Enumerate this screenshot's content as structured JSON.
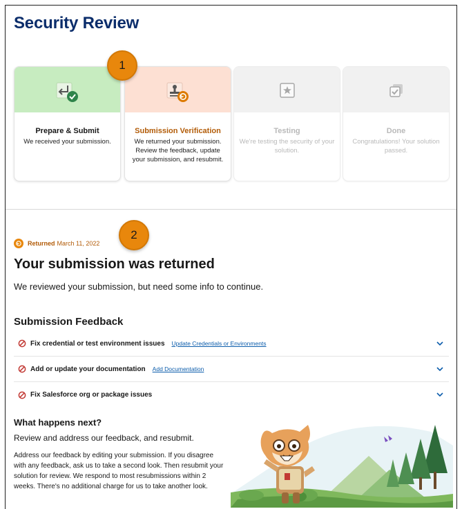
{
  "page": {
    "title": "Security Review"
  },
  "callouts": {
    "one": "1",
    "two": "2"
  },
  "stepper": {
    "steps": [
      {
        "title": "Prepare & Submit",
        "description": "We received your submission.",
        "state": "done",
        "icon": "enter-arrow-check-icon"
      },
      {
        "title": "Submission Verification",
        "description": "We returned your submission. Review the feedback, update your submission, and resubmit.",
        "state": "active",
        "icon": "stamp-returned-icon"
      },
      {
        "title": "Testing",
        "description": "We're testing the security of your solution.",
        "state": "pending",
        "icon": "star-square-icon"
      },
      {
        "title": "Done",
        "description": "Congratulations! Your solution passed.",
        "state": "pending",
        "icon": "stacked-check-icon"
      }
    ]
  },
  "status": {
    "label": "Returned",
    "date": "March 11, 2022"
  },
  "main": {
    "heading": "Your submission was returned",
    "subheading": "We reviewed your submission, but need some info to continue."
  },
  "feedback": {
    "heading": "Submission Feedback",
    "items": [
      {
        "title": "Fix credential or test environment issues",
        "link": "Update Credentials or Environments"
      },
      {
        "title": "Add or update your documentation",
        "link": "Add Documentation"
      },
      {
        "title": "Fix Salesforce org or package issues",
        "link": ""
      }
    ]
  },
  "next": {
    "heading": "What happens next?",
    "subheading": "Review and address our feedback, and resubmit.",
    "body": "Address our feedback by editing your submission. If you disagree with any feedback, ask us to take a second look. Then resubmit your solution for review. We respond to most resubmissions within 2 weeks. There's no additional charge for us to take another look."
  },
  "colors": {
    "title": "#0b2d6b",
    "done": "#c7ecc0",
    "active": "#fde0d3",
    "pending": "#f1f1f1",
    "accent_orange": "#e8870c",
    "error_red": "#c23934",
    "link": "#0b5cab"
  }
}
